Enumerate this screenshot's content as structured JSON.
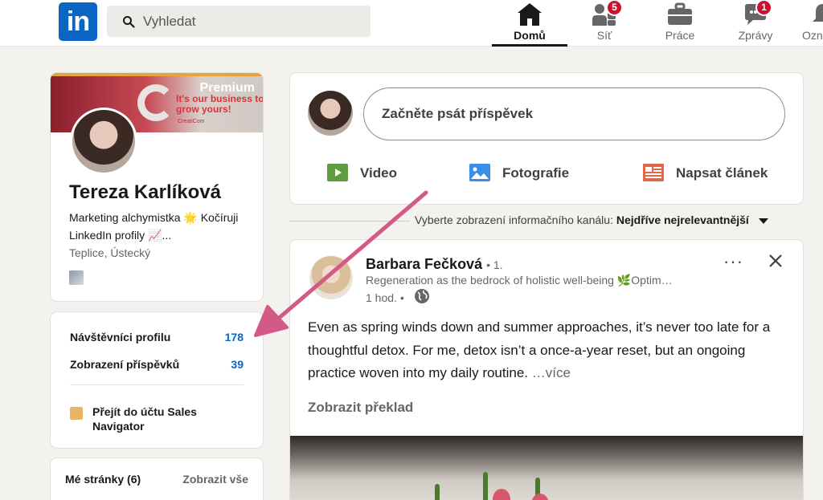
{
  "topbar": {
    "logo_text": "in",
    "search_placeholder": "Vyhledat",
    "nav": [
      {
        "label": "Domů",
        "icon": "home-icon",
        "active": true
      },
      {
        "label": "Síť",
        "icon": "network-icon",
        "badge": "5"
      },
      {
        "label": "Práce",
        "icon": "briefcase-icon"
      },
      {
        "label": "Zprávy",
        "icon": "messaging-icon",
        "badge": "1"
      },
      {
        "label": "Ozn",
        "icon": "bell-icon"
      }
    ]
  },
  "profile": {
    "banner_premium": "Premium",
    "banner_slogan": "It's our business to grow yours!",
    "banner_brand": "CreatiCom",
    "name": "Tereza Karlíková",
    "headline": "Marketing alchymistka 🌟 Kočíruji LinkedIn profily 📈...",
    "location": "Teplice, Ústecký"
  },
  "stats": {
    "visitors_label": "Návštěvníci profilu",
    "visitors_value": "178",
    "impressions_label": "Zobrazení příspěvků",
    "impressions_value": "39",
    "sales_navigator": "Přejít do účtu Sales Navigator"
  },
  "pages": {
    "title": "Mé stránky (6)",
    "view_all": "Zobrazit vše"
  },
  "composer": {
    "placeholder": "Začněte psát příspěvek",
    "actions": [
      {
        "label": "Video",
        "icon": "video-icon",
        "color": "#5f9b41"
      },
      {
        "label": "Fotografie",
        "icon": "photo-icon",
        "color": "#378fe9"
      },
      {
        "label": "Napsat článek",
        "icon": "article-icon",
        "color": "#e06847"
      }
    ]
  },
  "feed_sort": {
    "label": "Vyberte zobrazení informačního kanálu:",
    "value": "Nejdříve nejrelevantnější"
  },
  "post": {
    "author": "Barbara Fečková",
    "degree": "• 1.",
    "tagline": "Regeneration as the bedrock of holistic well-being 🌿Optim…",
    "time": "1 hod. •",
    "text": "Even as spring winds down and summer approaches, it’s never too late for a thoughtful detox. For me, detox isn’t a once-a-year reset, but an ongoing practice woven into my daily routine.",
    "more": "…více",
    "translate": "Zobrazit překlad",
    "more_menu": "···"
  },
  "colors": {
    "brand": "#0a66c2",
    "badge": "#cb112d",
    "background": "#f4f2ee",
    "arrow": "#d35a86"
  }
}
